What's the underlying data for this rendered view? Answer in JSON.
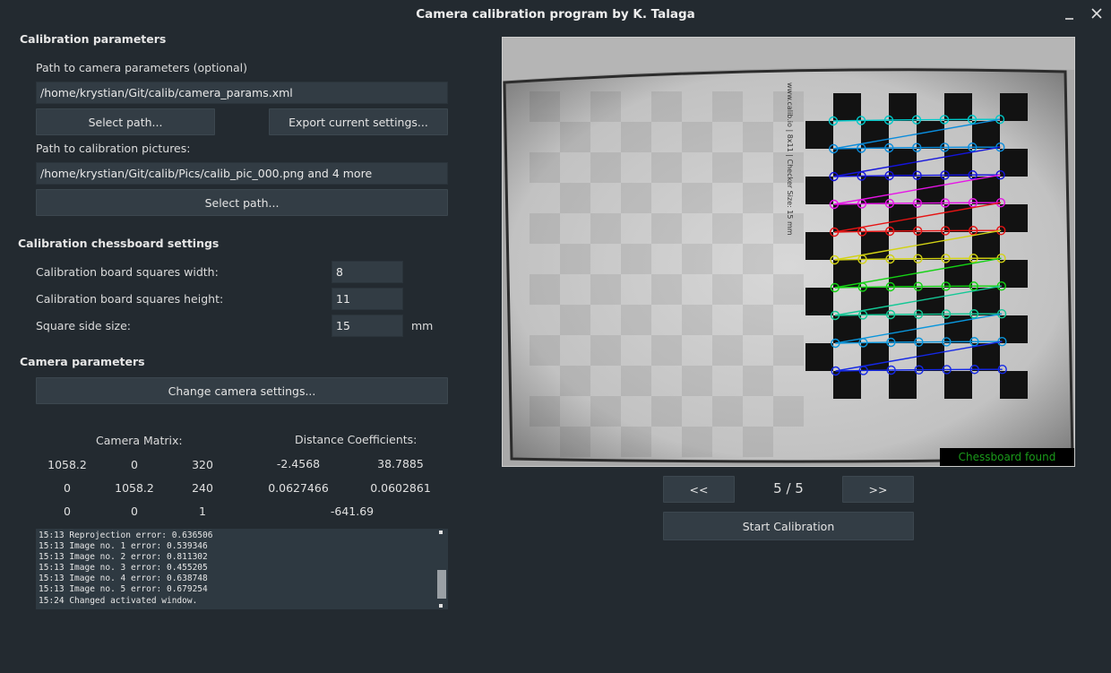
{
  "window": {
    "title": "Camera calibration program by K. Talaga"
  },
  "calibration_parameters": {
    "heading": "Calibration parameters",
    "camera_params_label": "Path to camera parameters (optional)",
    "camera_params_path": "/home/krystian/Git/calib/camera_params.xml",
    "select_path_label": "Select path...",
    "export_label": "Export current settings...",
    "pictures_label": "Path to calibration pictures:",
    "pictures_path": "/home/krystian/Git/calib/Pics/calib_pic_000.png and 4 more",
    "select_pictures_label": "Select path..."
  },
  "chessboard": {
    "heading": "Calibration chessboard settings",
    "width_label": "Calibration board squares width:",
    "width_value": "8",
    "height_label": "Calibration board squares height:",
    "height_value": "11",
    "side_label": "Square side size:",
    "side_value": "15",
    "unit": "mm"
  },
  "camera": {
    "heading": "Camera parameters",
    "change_settings_label": "Change camera settings...",
    "matrix_label": "Camera Matrix:",
    "coeff_label": "Distance Coefficients:",
    "matrix": [
      [
        "1058.2",
        "0",
        "320"
      ],
      [
        "0",
        "1058.2",
        "240"
      ],
      [
        "0",
        "0",
        "1"
      ]
    ],
    "coefficients": [
      [
        "-2.4568",
        "38.7885"
      ],
      [
        "0.0627466",
        "0.0602861"
      ],
      [
        "-641.69"
      ]
    ]
  },
  "log": {
    "lines": [
      "15:13 Reprojection error: 0.636506",
      "15:13 Image no. 1 error: 0.539346",
      "15:13 Image no. 2 error: 0.811302",
      "15:13 Image no. 3 error: 0.455205",
      "15:13 Image no. 4 error: 0.638748",
      "15:13 Image no. 5 error: 0.679254",
      "15:24 Changed activated window."
    ]
  },
  "viewer": {
    "status": "Chessboard found",
    "board_text": "www.calib.io | 8x11 | Checker Size: 15 mm",
    "prev_label": "<<",
    "next_label": ">>",
    "page_indicator": "5 / 5",
    "start_label": "Start Calibration",
    "row_colors": [
      "#00c8c8",
      "#0a8cdc",
      "#1414dc",
      "#e614e6",
      "#e61414",
      "#d2d214",
      "#14d214",
      "#14c896",
      "#0a96dc",
      "#1428e6"
    ]
  }
}
